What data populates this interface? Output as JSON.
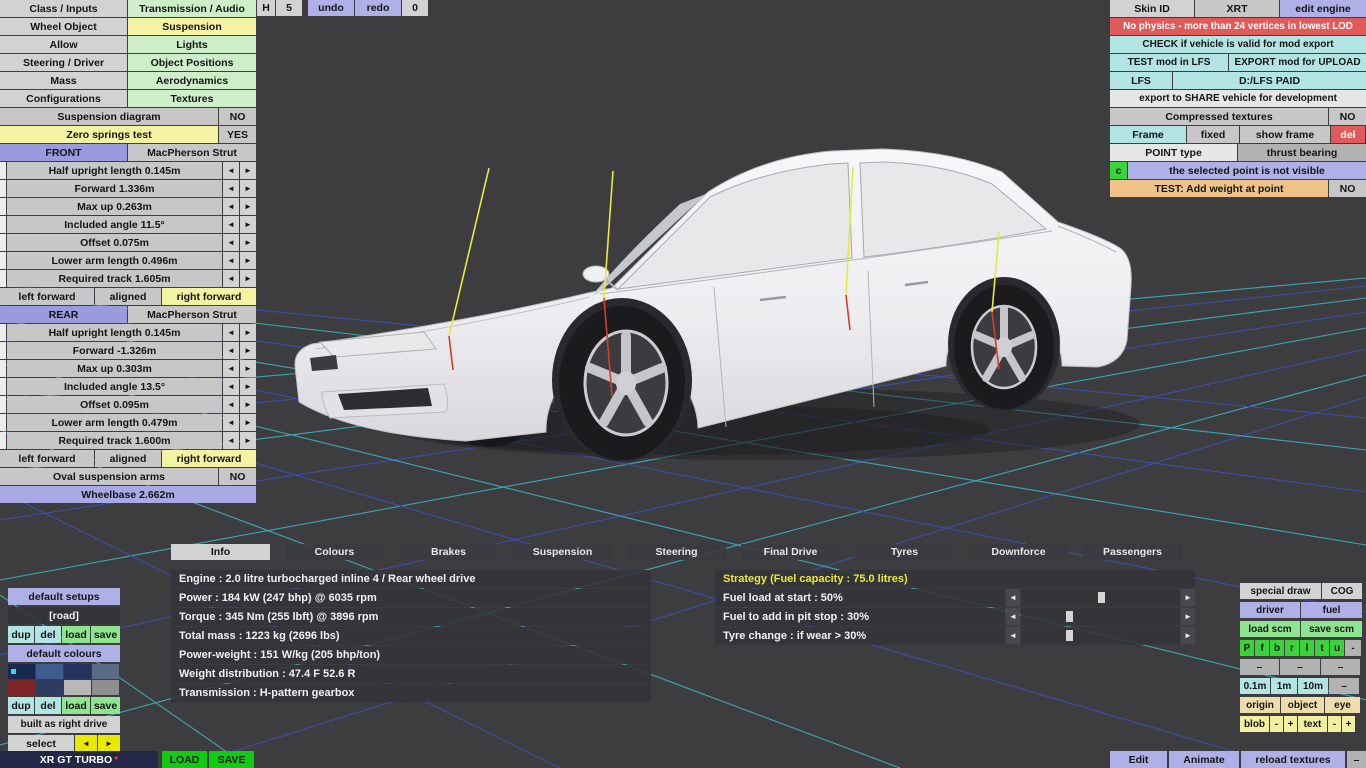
{
  "icons": {
    "arrow_left": "◄",
    "arrow_right": "►"
  },
  "menu": {
    "rows": [
      {
        "left": "Class / Inputs",
        "right": "Transmission / Audio"
      },
      {
        "left": "Wheel Object",
        "right": "Suspension"
      },
      {
        "left": "Allow",
        "right": "Lights"
      },
      {
        "left": "Steering / Driver",
        "right": "Object Positions"
      },
      {
        "left": "Mass",
        "right": "Aerodynamics"
      },
      {
        "left": "Configurations",
        "right": "Textures"
      }
    ]
  },
  "toolbar": {
    "h": "H",
    "five": "5",
    "undo": "undo",
    "redo": "redo",
    "zero": "0"
  },
  "suspension": {
    "diagram_label": "Suspension diagram",
    "diagram_value": "NO",
    "zero_label": "Zero springs test",
    "zero_value": "YES",
    "front_label": "FRONT",
    "front_type": "MacPherson Strut",
    "front_params": [
      "Half upright length 0.145m",
      "Forward 1.336m",
      "Max up 0.263m",
      "Included angle 11.5°",
      "Offset 0.075m",
      "Lower arm length 0.496m"
    ],
    "front_track": "Required track 1.605m",
    "rear_label": "REAR",
    "rear_type": "MacPherson Strut",
    "rear_params": [
      "Half upright length 0.145m",
      "Forward -1.326m",
      "Max up 0.303m",
      "Included angle 13.5°",
      "Offset 0.095m",
      "Lower arm length 0.479m"
    ],
    "rear_track": "Required track 1.600m",
    "align": {
      "left": "left forward",
      "mid": "aligned",
      "right": "right forward"
    },
    "oval_label": "Oval suspension arms",
    "oval_value": "NO",
    "wheelbase": "Wheelbase 2.662m"
  },
  "right_panel": {
    "skin_id": "Skin ID",
    "skin_value": "XRT",
    "edit_engine": "edit engine",
    "warning": "No physics - more than 24 vertices in lowest LOD",
    "check": "CHECK if vehicle is valid for mod export",
    "test_mod": "TEST mod in LFS",
    "export_mod": "EXPORT mod for UPLOAD",
    "lfs": "LFS",
    "lfs_path": "D:/LFS PAID",
    "share": "export to SHARE vehicle for development",
    "compressed_label": "Compressed textures",
    "compressed_value": "NO",
    "frame": "Frame",
    "fixed": "fixed",
    "show_frame": "show frame",
    "del": "del",
    "point_type": "POINT type",
    "point_value": "thrust bearing",
    "c": "c",
    "point_msg": "the selected point is not visible",
    "test_weight": "TEST: Add weight at point",
    "test_weight_value": "NO"
  },
  "tabs": {
    "items": [
      "Info",
      "Colours",
      "Brakes",
      "Suspension",
      "Steering",
      "Final Drive",
      "Tyres",
      "Downforce",
      "Passengers"
    ],
    "active": "Info"
  },
  "info": {
    "lines": [
      "Engine : 2.0 litre turbocharged inline 4 / Rear wheel drive",
      "Power : 184 kW (247 bhp) @ 6035 rpm",
      "Torque : 345 Nm (255 lbft) @ 3896 rpm",
      "Total mass : 1223 kg (2696 lbs)",
      "Power-weight : 151 W/kg (205 bhp/ton)",
      "Weight distribution : 47.4 F  52.6 R",
      "Transmission : H-pattern gearbox"
    ]
  },
  "strategy": {
    "header": "Strategy (Fuel capacity : 75.0 litres)",
    "header_color": "#e8e840",
    "rows": [
      {
        "label": "Fuel load at start : 50%",
        "value": 50
      },
      {
        "label": "Fuel to add in pit stop : 30%",
        "value": 30
      },
      {
        "label": "Tyre change : if wear > 30%",
        "value": 30
      }
    ]
  },
  "setups": {
    "default_setups": "default setups",
    "current": "[road]",
    "dup": "dup",
    "del": "del",
    "load": "load",
    "save": "save",
    "default_colours": "default colours",
    "built": "built as right drive",
    "select": "select"
  },
  "swatches": [
    "#17294e",
    "#3e5c8e",
    "#23355c",
    "#5a6b85",
    "#7e2626",
    "#2c3e60",
    "#b9b9b9",
    "#8f8f8f"
  ],
  "right_tools": {
    "special_draw": "special draw",
    "cog": "COG",
    "driver": "driver",
    "fuel": "fuel",
    "load_scm": "load scm",
    "save_scm": "save scm",
    "letters": [
      "P",
      "f",
      "b",
      "r",
      "l",
      "t",
      "u"
    ],
    "letter_extra": "-",
    "dash": "–",
    "d01": "0.1m",
    "d1": "1m",
    "d10": "10m",
    "origin": "origin",
    "object": "object",
    "eye": "eye",
    "blob": "blob",
    "minus": "-",
    "plus": "+",
    "text": "text"
  },
  "bottombar": {
    "vehicle": "XR GT TURBO",
    "star": "*",
    "load": "LOAD",
    "save": "SAVE",
    "edit": "Edit",
    "animate": "Animate",
    "reload": "reload textures",
    "minus": "–"
  },
  "colors": {
    "accent_green": "#10cb10",
    "panel_purple": "#b0b0e8",
    "panel_cyan": "#b2e4e4",
    "panel_yellow": "#f3f3a3",
    "warning_red": "#e05a5a",
    "highlight_orange": "#f0c488",
    "grid_cyan": "#3ad4e8",
    "grid_blue": "#3a56d8",
    "strategy_yellow": "#e8e840"
  }
}
